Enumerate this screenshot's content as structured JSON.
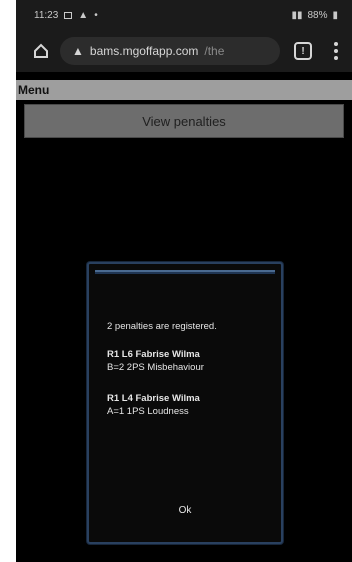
{
  "status_bar": {
    "time": "11:23",
    "right_text": "88%"
  },
  "browser": {
    "url_host": "bams.mgoffapp.com",
    "url_path": "/the"
  },
  "menu": {
    "label": "Menu"
  },
  "actions": {
    "view_penalties": "View penalties"
  },
  "dialog": {
    "message": "2 penalties are registered.",
    "penalties": [
      {
        "title": "R1 L6 Fabrise Wilma",
        "detail": "B=2 2PS Misbehaviour"
      },
      {
        "title": "R1 L4 Fabrise Wilma",
        "detail": "A=1 1PS Loudness"
      }
    ],
    "ok_label": "Ok"
  }
}
